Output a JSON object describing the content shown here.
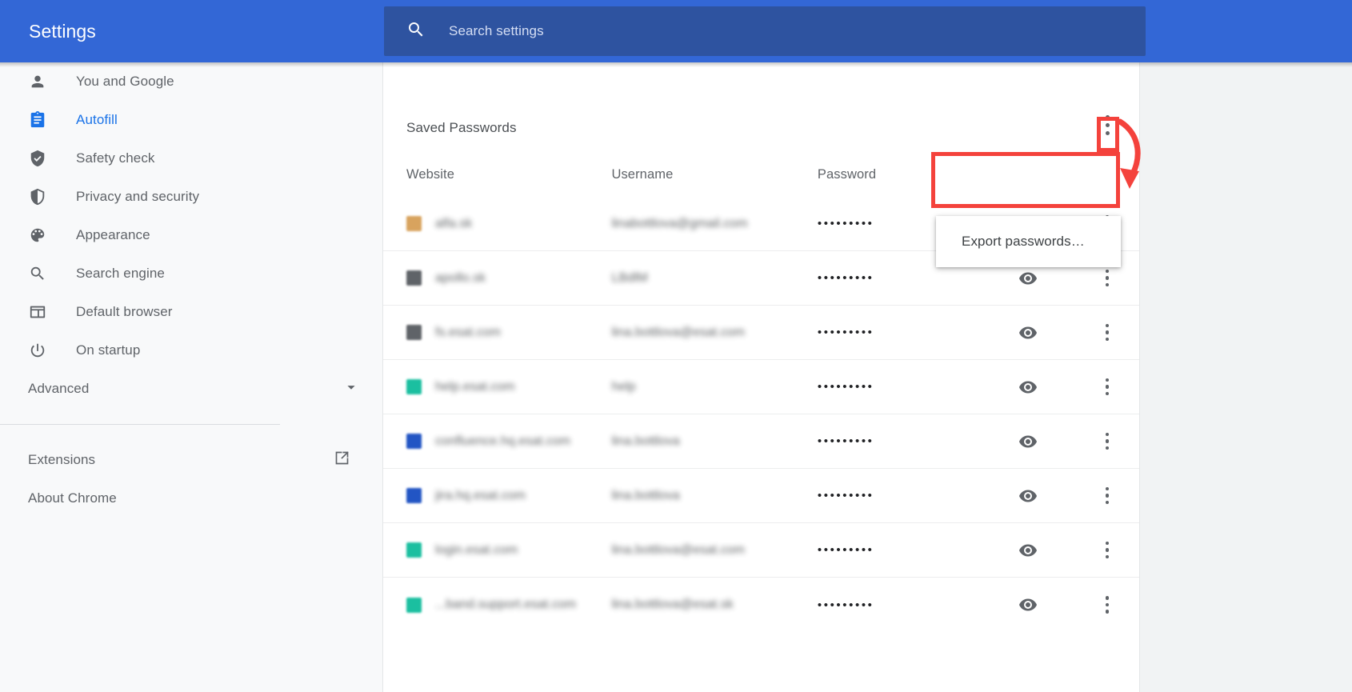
{
  "header": {
    "title": "Settings",
    "search": {
      "placeholder": "Search settings",
      "value": "",
      "icon": "search-icon"
    },
    "bar_color": "#3367d6",
    "search_bg": "#2e53a0"
  },
  "sidebar": {
    "items": [
      {
        "label": "You and Google",
        "icon": "person-icon",
        "active": false
      },
      {
        "label": "Autofill",
        "icon": "clipboard-icon",
        "active": true
      },
      {
        "label": "Safety check",
        "icon": "shield-check-icon",
        "active": false
      },
      {
        "label": "Privacy and security",
        "icon": "shield-icon",
        "active": false
      },
      {
        "label": "Appearance",
        "icon": "palette-icon",
        "active": false
      },
      {
        "label": "Search engine",
        "icon": "search-icon",
        "active": false
      },
      {
        "label": "Default browser",
        "icon": "browser-window-icon",
        "active": false
      },
      {
        "label": "On startup",
        "icon": "power-icon",
        "active": false
      }
    ],
    "advanced": {
      "label": "Advanced",
      "icon": "chevron-down-icon"
    },
    "footer": [
      {
        "label": "Extensions",
        "icon": "external-link-icon"
      },
      {
        "label": "About Chrome",
        "icon": ""
      }
    ],
    "active_color": "#1a73e8",
    "text_color": "#5f6368"
  },
  "main": {
    "section_title": "Saved Passwords",
    "overflow_menu_icon": "kebab-menu-icon",
    "columns": [
      "Website",
      "Username",
      "Password",
      "",
      ""
    ],
    "rows": [
      {
        "website": "alfa.sk",
        "username": "linabottlova@gmail.com",
        "password_mask": "•••••••••",
        "favicon_color": "#d8a35e",
        "eye_icon": "eye-icon",
        "menu_icon": "kebab-menu-icon"
      },
      {
        "website": "apollo.sk",
        "username": "LBdlM",
        "password_mask": "•••••••••",
        "favicon_color": "#5f6368",
        "eye_icon": "eye-icon",
        "menu_icon": "kebab-menu-icon"
      },
      {
        "website": "fs.esat.com",
        "username": "lina.bottlova@esat.com",
        "password_mask": "•••••••••",
        "favicon_color": "#5f6368",
        "eye_icon": "eye-icon",
        "menu_icon": "kebab-menu-icon"
      },
      {
        "website": "help.esat.com",
        "username": "help",
        "password_mask": "•••••••••",
        "favicon_color": "#1bbfa0",
        "eye_icon": "eye-icon",
        "menu_icon": "kebab-menu-icon"
      },
      {
        "website": "confluence.hq.esat.com",
        "username": "lina.bottlova",
        "password_mask": "•••••••••",
        "favicon_color": "#2255c4",
        "eye_icon": "eye-icon",
        "menu_icon": "kebab-menu-icon"
      },
      {
        "website": "jira.hq.esat.com",
        "username": "lina.bottlova",
        "password_mask": "•••••••••",
        "favicon_color": "#2255c4",
        "eye_icon": "eye-icon",
        "menu_icon": "kebab-menu-icon"
      },
      {
        "website": "login.esat.com",
        "username": "lina.bottlova@esat.com",
        "password_mask": "•••••••••",
        "favicon_color": "#1bbfa0",
        "eye_icon": "eye-icon",
        "menu_icon": "kebab-menu-icon"
      },
      {
        "website": "...band.support.esat.com",
        "username": "lina.bottlova@esat.sk",
        "password_mask": "•••••••••",
        "favicon_color": "#1bbfa0",
        "eye_icon": "eye-icon",
        "menu_icon": "kebab-menu-icon"
      }
    ]
  },
  "popup": {
    "items": [
      {
        "label": "Export passwords…"
      }
    ]
  },
  "annotations": {
    "color": "#f4423c",
    "kebab_highlight": true,
    "popup_highlight": true,
    "arrow": "curved-arrow-down"
  }
}
